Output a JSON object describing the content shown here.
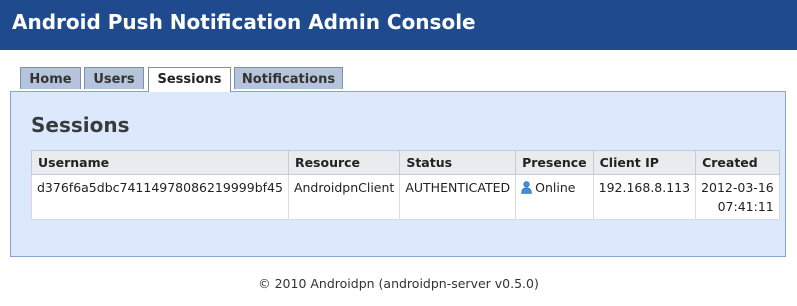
{
  "header": {
    "title": "Android Push Notification Admin Console"
  },
  "tabs": [
    {
      "label": "Home",
      "active": false
    },
    {
      "label": "Users",
      "active": false
    },
    {
      "label": "Sessions",
      "active": true
    },
    {
      "label": "Notifications",
      "active": false
    }
  ],
  "panel": {
    "title": "Sessions"
  },
  "table": {
    "columns": [
      "Username",
      "Resource",
      "Status",
      "Presence",
      "Client IP",
      "Created"
    ],
    "rows": [
      {
        "username": "d376f6a5dbc74114978086219999bf45",
        "resource": "AndroidpnClient",
        "status": "AUTHENTICATED",
        "presence": "Online",
        "presence_icon": "user-online-icon",
        "client_ip": "192.168.8.113",
        "created_date": "2012-03-16",
        "created_time": "07:41:11"
      }
    ]
  },
  "footer": {
    "text": "© 2010 Androidpn (androidpn-server v0.5.0)"
  },
  "colors": {
    "header_bg": "#1f4a8e",
    "tab_bg": "#b6c3dc",
    "panel_bg": "#dce8fb",
    "presence_icon": "#3f8fd8"
  }
}
